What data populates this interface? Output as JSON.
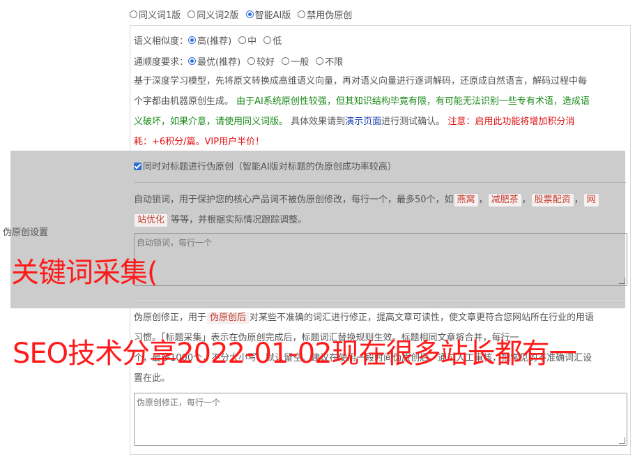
{
  "modes": {
    "items": [
      {
        "label": "同义词1版",
        "selected": false
      },
      {
        "label": "同义词2版",
        "selected": false
      },
      {
        "label": "智能AI版",
        "selected": true
      },
      {
        "label": "禁用伪原创",
        "selected": false
      }
    ]
  },
  "similarity": {
    "label": "语义相似度：",
    "options": [
      {
        "label": "高(推荐)",
        "selected": true
      },
      {
        "label": "中",
        "selected": false
      },
      {
        "label": "低",
        "selected": false
      }
    ]
  },
  "fluency": {
    "label": "通顺度要求：",
    "options": [
      {
        "label": "最优(推荐)",
        "selected": true
      },
      {
        "label": "较好",
        "selected": false
      },
      {
        "label": "一般",
        "selected": false
      },
      {
        "label": "不限",
        "selected": false
      }
    ]
  },
  "description": {
    "line1": "基于深度学习模型，先将原文转换成高维语义向量，再对语义向量进行逐词解码，还原成自然语言，解码过程中每",
    "line2_plain": "个字都由机器原创生成。 ",
    "line2_green": "由于AI系统原创性较强，但其知识结构毕竟有限，有可能无法识别一些专有术语，造成语",
    "line3_green": "义破坏，如果介意，请使用同义词版。",
    "line3_plain": " 具体效果请到",
    "line3_link": "演示页面",
    "line3_plain2": "进行测试确认。 ",
    "line3_red": "注意：启用此功能将增加积分消",
    "line4_red": "耗：+6积分/篇。VIP用户半价！"
  },
  "title_checkbox": {
    "label": "同时对标题进行伪原创（智能AI版对标题的伪原创成功率较高）",
    "checked": true
  },
  "section_label": "伪原创设置",
  "lock": {
    "text1": "自动锁词，用于保护您的核心产品词不被伪原创修改，每行一个，最多50个，如",
    "tags": [
      "燕窝",
      "减肥茶",
      "股票配资",
      "网",
      "站优化"
    ],
    "sep": "，",
    "text2": "等等，并根据实际情况跟踪调整。",
    "placeholder": "自动锁词，每行一个"
  },
  "correct": {
    "text_a": "伪原创修正，用于",
    "tag": "伪原创后",
    "text_b": "对某些不准确的词汇进行修正，提高文章可读性，使文章更符合您网站所在行业的用语",
    "line2": "习惯。「标题采集」表示在伪原创完成后，标题词汇替换规则生效。标题相同文章将合并，每行一",
    "line3": "个，最多1000个，不分大小写，默认留空。建议在使用一段时间伪原创后，通过人工审核，把常见的不准确词汇设",
    "line4": "置在此。",
    "placeholder": "伪原创修正，每行一个"
  },
  "overlay": {
    "line1": "关键词采集(",
    "line2": "SEO技术分享2022-01-02现在很多站长都有一"
  }
}
